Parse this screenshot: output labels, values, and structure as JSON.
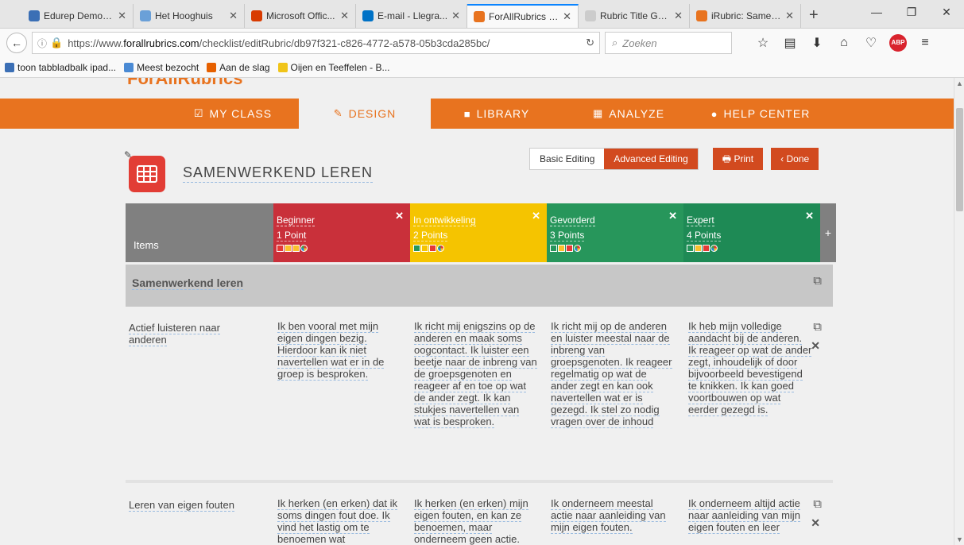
{
  "browser": {
    "tabs": [
      {
        "label": "Edurep Demon...",
        "color": "#3b6fb5"
      },
      {
        "label": "Het Hooghuis",
        "color": "#6aa0d8"
      },
      {
        "label": "Microsoft Offic...",
        "color": "#d83b01"
      },
      {
        "label": "E-mail - Llegra...",
        "color": "#0072c6"
      },
      {
        "label": "ForAllRubrics | ...",
        "color": "#e8731f"
      },
      {
        "label": "Rubric Title Goes H...",
        "color": "#cccccc"
      },
      {
        "label": "iRubric: Samen...",
        "color": "#e8731f"
      }
    ],
    "url_prefix": "https://www.",
    "url_domain": "forallrubrics.com",
    "url_path": "/checklist/editRubric/db97f321-c826-4772-a578-05b3cda285bc/",
    "search_placeholder": "Zoeken",
    "bookmarks": [
      {
        "label": "toon tabbladbalk ipad...",
        "color": "#3b6fb5"
      },
      {
        "label": "Meest bezocht",
        "color": "#4a8ad4"
      },
      {
        "label": "Aan de slag",
        "color": "#e66000"
      },
      {
        "label": "Oijen en Teeffelen - B...",
        "color": "#f0c419"
      }
    ]
  },
  "nav": {
    "items": [
      {
        "label": "MY CLASS",
        "icon": "☑"
      },
      {
        "label": "DESIGN",
        "icon": "✎"
      },
      {
        "label": "LIBRARY",
        "icon": "■"
      },
      {
        "label": "ANALYZE",
        "icon": "▦"
      },
      {
        "label": "HELP CENTER",
        "icon": "●"
      }
    ],
    "active": "DESIGN"
  },
  "toolbar": {
    "basic": "Basic Editing",
    "advanced": "Advanced Editing",
    "print": "Print",
    "done": "Done"
  },
  "rubric": {
    "title": "SAMENWERKEND LEREN",
    "items_header": "Items",
    "levels": [
      {
        "name": "Beginner",
        "points": "1 Point",
        "color": "#c9303a"
      },
      {
        "name": "In ontwikkeling",
        "points": "2 Points",
        "color": "#f5c400"
      },
      {
        "name": "Gevorderd",
        "points": "3 Points",
        "color": "#27965b"
      },
      {
        "name": "Expert",
        "points": "4 Points",
        "color": "#1e8a55"
      }
    ],
    "section": "Samenwerkend leren",
    "criteria": [
      {
        "name": "Actief luisteren naar anderen",
        "descriptions": [
          "Ik ben vooral met mijn eigen dingen bezig. Hierdoor kan ik niet navertellen wat er in de groep is besproken.",
          "Ik richt mij enigszins op de anderen en maak soms oogcontact. Ik luister een beetje naar de inbreng van de groepsgenoten en reageer af en toe op wat de ander zegt. Ik kan stukjes navertellen van wat is besproken.",
          "Ik richt mij op de anderen en luister meestal naar de inbreng van groepsgenoten. Ik reageer regelmatig op wat de ander zegt en kan ook navertellen wat er is gezegd. Ik stel zo nodig vragen over de inhoud",
          "Ik heb mijn volledige aandacht bij de anderen. Ik reageer op wat de ander zegt, inhoudelijk of door bijvoorbeeld bevestigend te knikken. Ik kan goed voortbouwen op wat eerder gezegd is."
        ]
      },
      {
        "name": "Leren van eigen fouten",
        "descriptions": [
          "Ik herken (en erken) dat ik soms dingen fout doe. Ik vind het lastig om te benoemen wat",
          "Ik herken (en erken) mijn eigen fouten, en kan ze benoemen, maar onderneem geen actie.",
          "Ik onderneem meestal actie naar aanleiding van mijn eigen fouten.",
          "Ik onderneem altijd actie naar aanleiding van mijn eigen fouten en leer"
        ]
      }
    ]
  }
}
